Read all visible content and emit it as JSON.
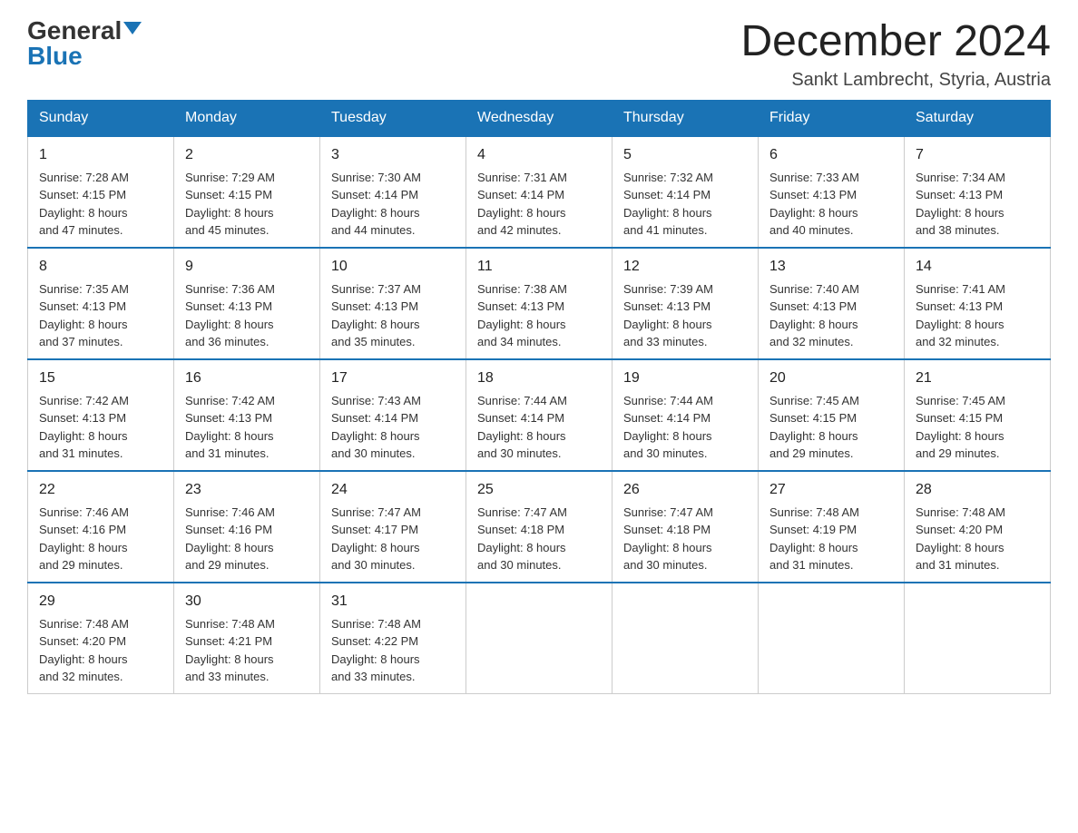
{
  "header": {
    "logo_general": "General",
    "logo_blue": "Blue",
    "month_title": "December 2024",
    "subtitle": "Sankt Lambrecht, Styria, Austria"
  },
  "weekdays": [
    "Sunday",
    "Monday",
    "Tuesday",
    "Wednesday",
    "Thursday",
    "Friday",
    "Saturday"
  ],
  "weeks": [
    [
      {
        "day": "1",
        "sunrise": "7:28 AM",
        "sunset": "4:15 PM",
        "daylight": "8 hours and 47 minutes."
      },
      {
        "day": "2",
        "sunrise": "7:29 AM",
        "sunset": "4:15 PM",
        "daylight": "8 hours and 45 minutes."
      },
      {
        "day": "3",
        "sunrise": "7:30 AM",
        "sunset": "4:14 PM",
        "daylight": "8 hours and 44 minutes."
      },
      {
        "day": "4",
        "sunrise": "7:31 AM",
        "sunset": "4:14 PM",
        "daylight": "8 hours and 42 minutes."
      },
      {
        "day": "5",
        "sunrise": "7:32 AM",
        "sunset": "4:14 PM",
        "daylight": "8 hours and 41 minutes."
      },
      {
        "day": "6",
        "sunrise": "7:33 AM",
        "sunset": "4:13 PM",
        "daylight": "8 hours and 40 minutes."
      },
      {
        "day": "7",
        "sunrise": "7:34 AM",
        "sunset": "4:13 PM",
        "daylight": "8 hours and 38 minutes."
      }
    ],
    [
      {
        "day": "8",
        "sunrise": "7:35 AM",
        "sunset": "4:13 PM",
        "daylight": "8 hours and 37 minutes."
      },
      {
        "day": "9",
        "sunrise": "7:36 AM",
        "sunset": "4:13 PM",
        "daylight": "8 hours and 36 minutes."
      },
      {
        "day": "10",
        "sunrise": "7:37 AM",
        "sunset": "4:13 PM",
        "daylight": "8 hours and 35 minutes."
      },
      {
        "day": "11",
        "sunrise": "7:38 AM",
        "sunset": "4:13 PM",
        "daylight": "8 hours and 34 minutes."
      },
      {
        "day": "12",
        "sunrise": "7:39 AM",
        "sunset": "4:13 PM",
        "daylight": "8 hours and 33 minutes."
      },
      {
        "day": "13",
        "sunrise": "7:40 AM",
        "sunset": "4:13 PM",
        "daylight": "8 hours and 32 minutes."
      },
      {
        "day": "14",
        "sunrise": "7:41 AM",
        "sunset": "4:13 PM",
        "daylight": "8 hours and 32 minutes."
      }
    ],
    [
      {
        "day": "15",
        "sunrise": "7:42 AM",
        "sunset": "4:13 PM",
        "daylight": "8 hours and 31 minutes."
      },
      {
        "day": "16",
        "sunrise": "7:42 AM",
        "sunset": "4:13 PM",
        "daylight": "8 hours and 31 minutes."
      },
      {
        "day": "17",
        "sunrise": "7:43 AM",
        "sunset": "4:14 PM",
        "daylight": "8 hours and 30 minutes."
      },
      {
        "day": "18",
        "sunrise": "7:44 AM",
        "sunset": "4:14 PM",
        "daylight": "8 hours and 30 minutes."
      },
      {
        "day": "19",
        "sunrise": "7:44 AM",
        "sunset": "4:14 PM",
        "daylight": "8 hours and 30 minutes."
      },
      {
        "day": "20",
        "sunrise": "7:45 AM",
        "sunset": "4:15 PM",
        "daylight": "8 hours and 29 minutes."
      },
      {
        "day": "21",
        "sunrise": "7:45 AM",
        "sunset": "4:15 PM",
        "daylight": "8 hours and 29 minutes."
      }
    ],
    [
      {
        "day": "22",
        "sunrise": "7:46 AM",
        "sunset": "4:16 PM",
        "daylight": "8 hours and 29 minutes."
      },
      {
        "day": "23",
        "sunrise": "7:46 AM",
        "sunset": "4:16 PM",
        "daylight": "8 hours and 29 minutes."
      },
      {
        "day": "24",
        "sunrise": "7:47 AM",
        "sunset": "4:17 PM",
        "daylight": "8 hours and 30 minutes."
      },
      {
        "day": "25",
        "sunrise": "7:47 AM",
        "sunset": "4:18 PM",
        "daylight": "8 hours and 30 minutes."
      },
      {
        "day": "26",
        "sunrise": "7:47 AM",
        "sunset": "4:18 PM",
        "daylight": "8 hours and 30 minutes."
      },
      {
        "day": "27",
        "sunrise": "7:48 AM",
        "sunset": "4:19 PM",
        "daylight": "8 hours and 31 minutes."
      },
      {
        "day": "28",
        "sunrise": "7:48 AM",
        "sunset": "4:20 PM",
        "daylight": "8 hours and 31 minutes."
      }
    ],
    [
      {
        "day": "29",
        "sunrise": "7:48 AM",
        "sunset": "4:20 PM",
        "daylight": "8 hours and 32 minutes."
      },
      {
        "day": "30",
        "sunrise": "7:48 AM",
        "sunset": "4:21 PM",
        "daylight": "8 hours and 33 minutes."
      },
      {
        "day": "31",
        "sunrise": "7:48 AM",
        "sunset": "4:22 PM",
        "daylight": "8 hours and 33 minutes."
      },
      null,
      null,
      null,
      null
    ]
  ],
  "labels": {
    "sunrise": "Sunrise:",
    "sunset": "Sunset:",
    "daylight": "Daylight:"
  }
}
